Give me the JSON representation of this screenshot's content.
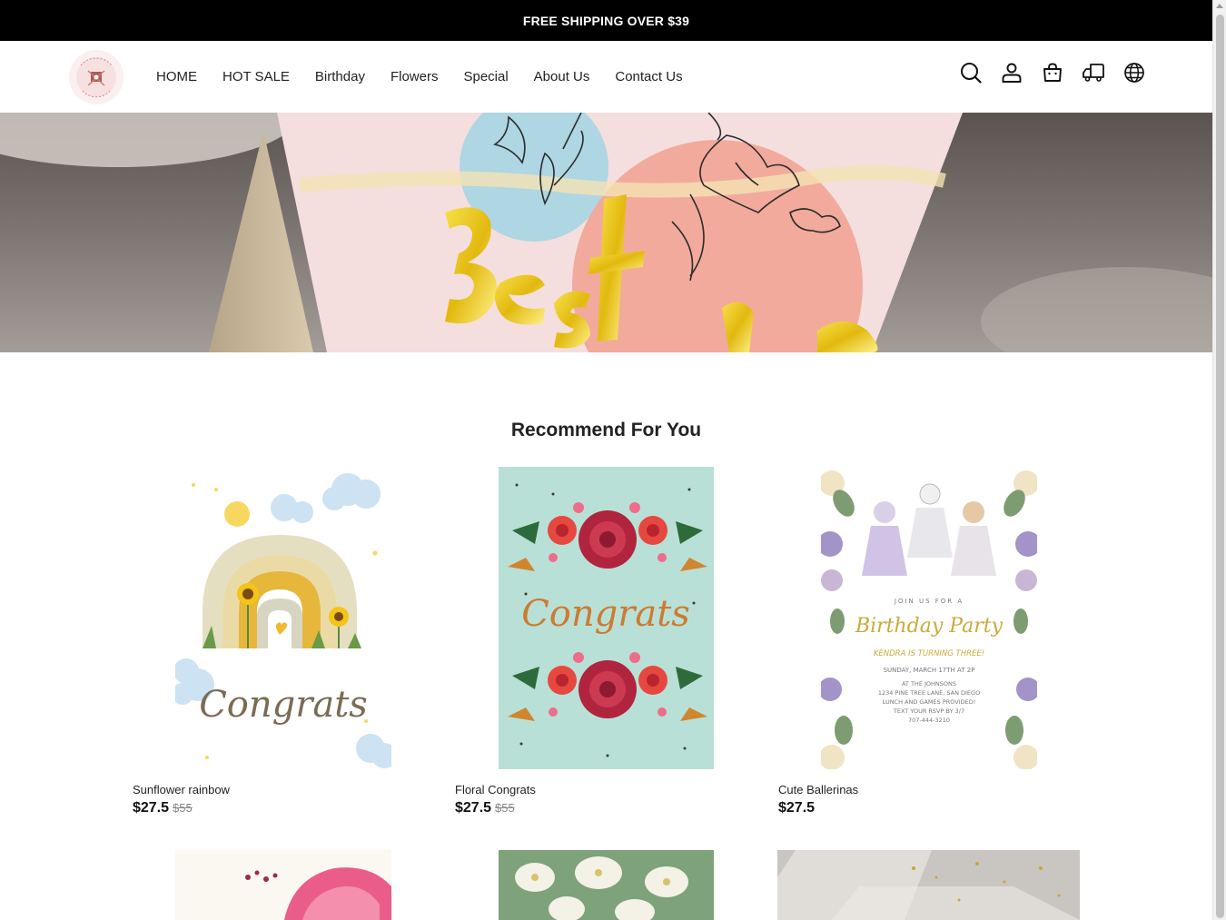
{
  "announcement": {
    "text": "FREE SHIPPING OVER $39"
  },
  "header": {
    "logo_alt": "HANDWORKS",
    "nav": [
      {
        "label": "HOME"
      },
      {
        "label": "HOT SALE"
      },
      {
        "label": "Birthday"
      },
      {
        "label": "Flowers"
      },
      {
        "label": "Special"
      },
      {
        "label": "About Us"
      },
      {
        "label": "Contact Us"
      }
    ],
    "icons": [
      "search-icon",
      "account-icon",
      "cart-icon",
      "shipping-truck-icon",
      "language-globe-icon"
    ]
  },
  "hero": {
    "card_text": "Best Wishes"
  },
  "recommend": {
    "title": "Recommend For You",
    "products": [
      {
        "name": "Sunflower rainbow",
        "price": "$27.5",
        "old_price": "$55",
        "card_text": "Congrats"
      },
      {
        "name": "Floral Congrats",
        "price": "$27.5",
        "old_price": "$55",
        "card_text": "Congrats"
      },
      {
        "name": "Cute Ballerinas",
        "price": "$27.5",
        "old_price": "",
        "card_lines": [
          "JOIN US FOR A",
          "Birthday Party",
          "KENDRA IS TURNING THREE!",
          "SUNDAY, MARCH 17TH AT 2P",
          "AT THE JOHNSONS",
          "1234 PINE TREE LANE, SAN DIEGO",
          "LUNCH AND GAMES PROVIDED!",
          "TEXT YOUR RSVP BY 3/7",
          "707-444-3210"
        ]
      }
    ]
  },
  "colors": {
    "topbar_bg": "#000000",
    "topbar_text": "#ffffff",
    "accent_gold": "#e8c21a"
  }
}
